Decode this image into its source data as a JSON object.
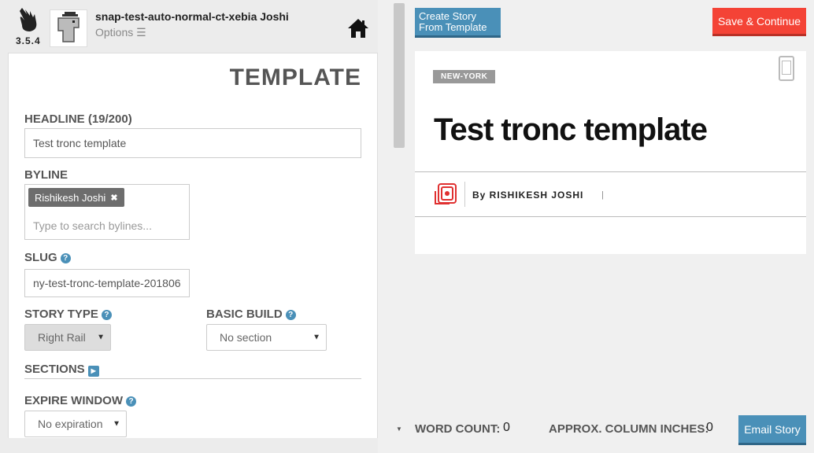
{
  "app": {
    "version": "3.5.4",
    "user_name": "snap-test-auto-normal-ct-xebia Joshi",
    "options_label": "Options ☰"
  },
  "panel": {
    "title": "TEMPLATE",
    "headline_label": "HEADLINE (19/200)",
    "headline_value": "Test tronc template",
    "byline_label": "BYLINE",
    "byline_chip": "Rishikesh Joshi",
    "byline_placeholder": "Type to search bylines...",
    "slug_label": "SLUG",
    "slug_value": "ny-test-tronc-template-201806",
    "story_type_label": "STORY TYPE",
    "story_type_value": "Right Rail",
    "basic_build_label": "BASIC BUILD",
    "basic_build_value": "No section",
    "sections_label": "SECTIONS",
    "expire_label": "EXPIRE WINDOW",
    "expire_value": "No expiration"
  },
  "toolbar": {
    "create_from_template": "Create Story From Template",
    "save_continue": "Save & Continue"
  },
  "preview": {
    "section_tag": "NEW-YORK",
    "headline": "Test tronc template",
    "byline": "By RISHIKESH JOSHI",
    "pipe": "|"
  },
  "footer": {
    "word_count_label": "WORD COUNT:",
    "word_count_value": "0",
    "column_inches_label": "APPROX. COLUMN INCHES:",
    "column_inches_value": "0",
    "email_story": "Email Story"
  },
  "colors": {
    "accent_blue": "#4a90b8",
    "save_red": "#f44336",
    "logo_red": "#e03030"
  }
}
